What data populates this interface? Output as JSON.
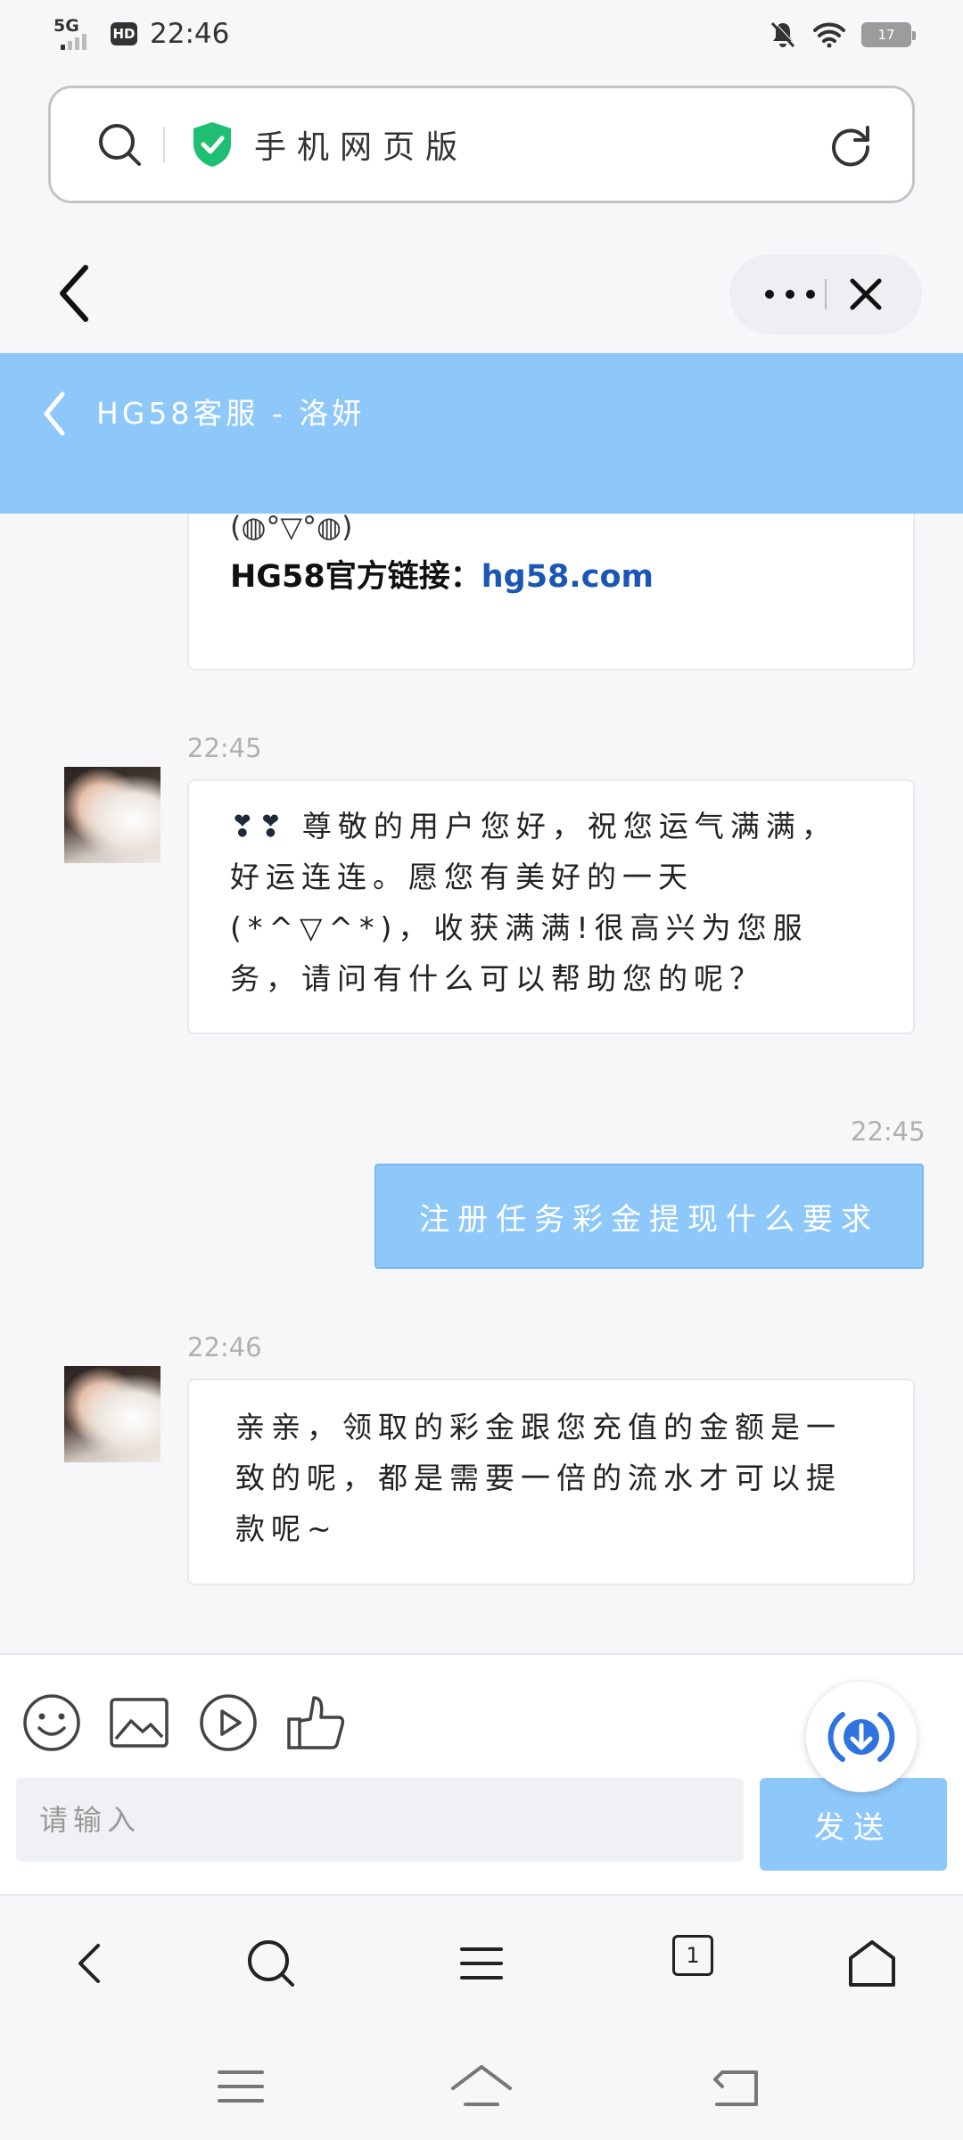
{
  "status_bar": {
    "network": "5G",
    "hd": "HD",
    "time": "22:46",
    "battery": "17"
  },
  "address_bar": {
    "title": "手机网页版"
  },
  "chat_header": {
    "title": "HG58客服 - 洛妍"
  },
  "messages": {
    "m1": {
      "emote": "(◍°▽°◍)",
      "link_label": "HG58官方链接：",
      "link_text": "hg58.com"
    },
    "m2": {
      "time": "22:45",
      "hearts": "❣❣",
      "text": "尊敬的用户您好，祝您运气满满，好运连连。愿您有美好的一天(*^▽^*)，收获满满!很高兴为您服务，请问有什么可以帮助您的呢？"
    },
    "m3": {
      "time": "22:45",
      "text": "注册任务彩金提现什么要求"
    },
    "m4": {
      "time": "22:46",
      "text": "亲亲，领取的彩金跟您充值的金额是一致的呢，都是需要一倍的流水才可以提款呢~"
    }
  },
  "composer": {
    "placeholder": "请输入",
    "send_label": "发送"
  },
  "browser_nav": {
    "tab_count": "1"
  },
  "colors": {
    "accent": "#8ec8fb",
    "link": "#1b56b5",
    "shield": "#1fbf73"
  },
  "icons": [
    "search-icon",
    "shield-check-icon",
    "reload-icon",
    "back-arrow-icon",
    "more-dots-icon",
    "close-icon",
    "emoji-icon",
    "image-icon",
    "video-icon",
    "thumbs-up-icon",
    "download-icon",
    "tabs-icon",
    "home-icon",
    "menu-icon"
  ]
}
